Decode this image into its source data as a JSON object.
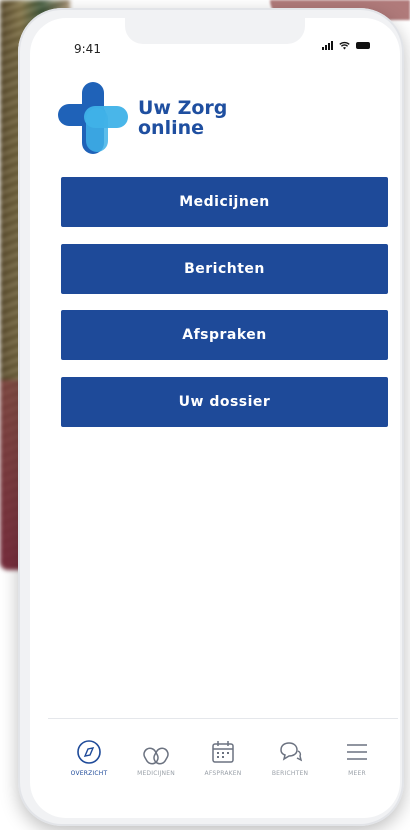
{
  "status_bar": {
    "time": "9:41"
  },
  "logo": {
    "line1": "Uw Zorg",
    "line2": "online"
  },
  "menu": [
    {
      "label": "Medicijnen"
    },
    {
      "label": "Berichten"
    },
    {
      "label": "Afspraken"
    },
    {
      "label": "Uw dossier"
    }
  ],
  "tabbar": [
    {
      "label": "OVERZICHT",
      "icon": "compass-icon",
      "active": true
    },
    {
      "label": "MEDICIJNEN",
      "icon": "pill-icon",
      "active": false
    },
    {
      "label": "AFSPRAKEN",
      "icon": "calendar-icon",
      "active": false
    },
    {
      "label": "BERICHTEN",
      "icon": "chat-icon",
      "active": false
    },
    {
      "label": "MEER",
      "icon": "menu-icon",
      "active": false
    }
  ],
  "colors": {
    "primary": "#1e4a99",
    "logo_dark": "#1f62b8",
    "logo_light": "#3fb2e8"
  }
}
